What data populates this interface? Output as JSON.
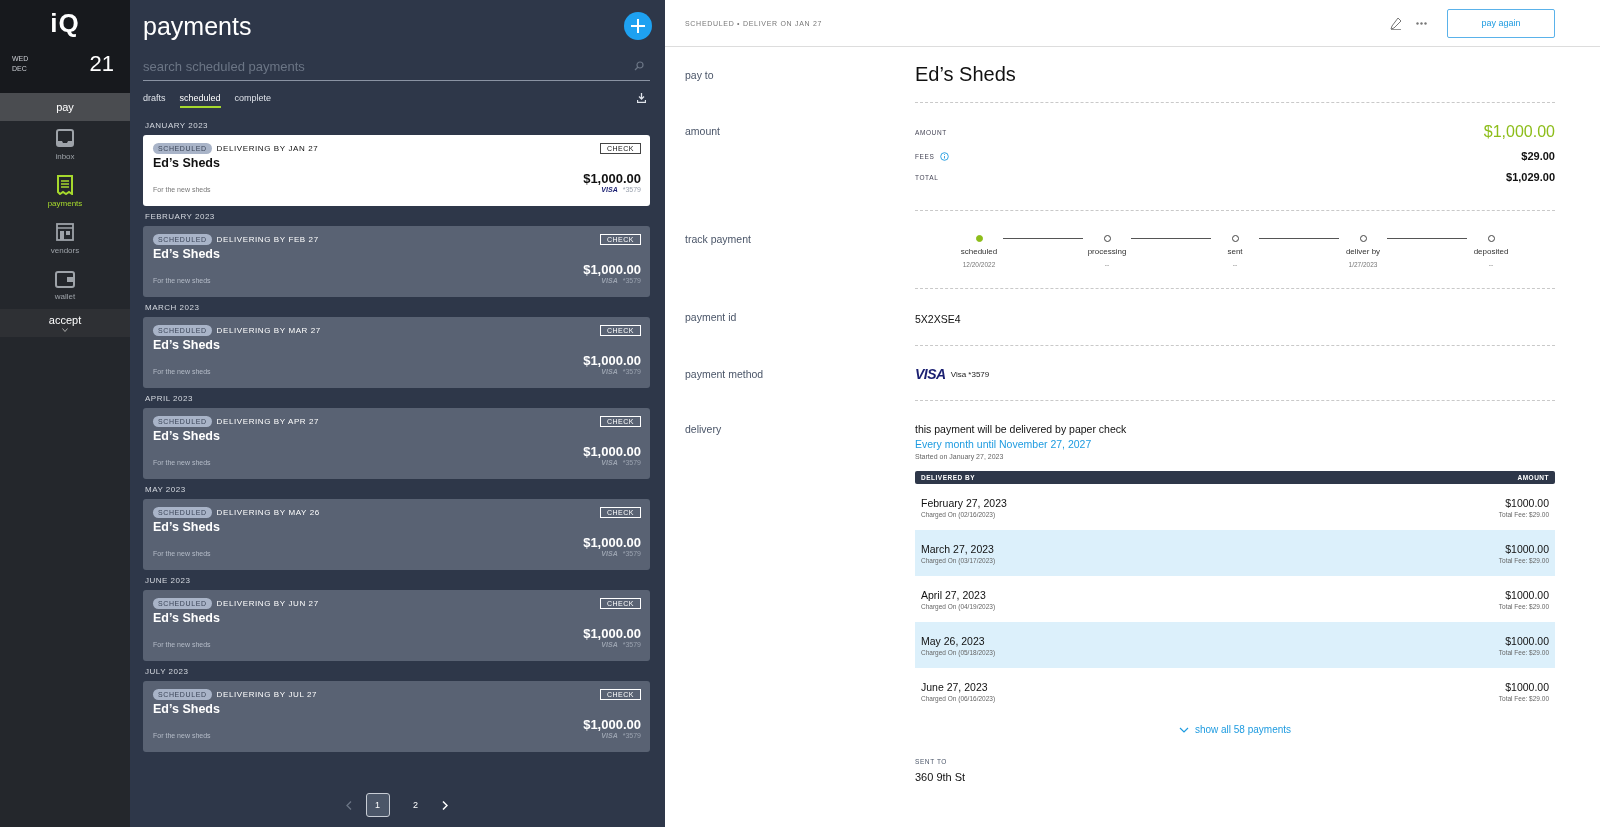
{
  "rail": {
    "logo": "iQ",
    "weekday": "WED",
    "month": "DEC",
    "day": "21",
    "nav": [
      {
        "label": "pay",
        "kind": "section",
        "selected": true
      },
      {
        "label": "inbox",
        "kind": "item",
        "selected": false
      },
      {
        "label": "payments",
        "kind": "item",
        "selected": true
      },
      {
        "label": "vendors",
        "kind": "item",
        "selected": false
      },
      {
        "label": "wallet",
        "kind": "item",
        "selected": false
      },
      {
        "label": "accept",
        "kind": "section",
        "selected": false
      }
    ]
  },
  "payments": {
    "title": "payments",
    "search": {
      "placeholder": "search scheduled payments"
    },
    "tabs": [
      {
        "label": "drafts",
        "selected": false
      },
      {
        "label": "scheduled",
        "selected": true
      },
      {
        "label": "complete",
        "selected": false
      }
    ],
    "groups": [
      {
        "month": "JANUARY 2023",
        "card": {
          "status": "SCHEDULED",
          "delivering": "DELIVERING BY JAN 27",
          "method": "CHECK",
          "payee": "Ed’s Sheds",
          "memo": "For the new sheds",
          "amount": "$1,000.00",
          "brand": "VISA",
          "last4": "*3579",
          "selected": true
        }
      },
      {
        "month": "FEBRUARY 2023",
        "card": {
          "status": "SCHEDULED",
          "delivering": "DELIVERING BY FEB 27",
          "method": "CHECK",
          "payee": "Ed’s Sheds",
          "memo": "For the new sheds",
          "amount": "$1,000.00",
          "brand": "VISA",
          "last4": "*3579",
          "selected": false
        }
      },
      {
        "month": "MARCH 2023",
        "card": {
          "status": "SCHEDULED",
          "delivering": "DELIVERING BY MAR 27",
          "method": "CHECK",
          "payee": "Ed’s Sheds",
          "memo": "For the new sheds",
          "amount": "$1,000.00",
          "brand": "VISA",
          "last4": "*3579",
          "selected": false
        }
      },
      {
        "month": "APRIL 2023",
        "card": {
          "status": "SCHEDULED",
          "delivering": "DELIVERING BY APR 27",
          "method": "CHECK",
          "payee": "Ed’s Sheds",
          "memo": "For the new sheds",
          "amount": "$1,000.00",
          "brand": "VISA",
          "last4": "*3579",
          "selected": false
        }
      },
      {
        "month": "MAY 2023",
        "card": {
          "status": "SCHEDULED",
          "delivering": "DELIVERING BY MAY 26",
          "method": "CHECK",
          "payee": "Ed’s Sheds",
          "memo": "For the new sheds",
          "amount": "$1,000.00",
          "brand": "VISA",
          "last4": "*3579",
          "selected": false
        }
      },
      {
        "month": "JUNE 2023",
        "card": {
          "status": "SCHEDULED",
          "delivering": "DELIVERING BY JUN 27",
          "method": "CHECK",
          "payee": "Ed’s Sheds",
          "memo": "For the new sheds",
          "amount": "$1,000.00",
          "brand": "VISA",
          "last4": "*3579",
          "selected": false
        }
      },
      {
        "month": "JULY 2023",
        "card": {
          "status": "SCHEDULED",
          "delivering": "DELIVERING BY JUL 27",
          "method": "CHECK",
          "payee": "Ed’s Sheds",
          "memo": "For the new sheds",
          "amount": "$1,000.00",
          "brand": "VISA",
          "last4": "*3579",
          "selected": false
        }
      }
    ],
    "pagination": [
      {
        "label": "1",
        "selected": true
      },
      {
        "label": "2",
        "selected": false
      }
    ]
  },
  "detail": {
    "status_line": "SCHEDULED • DELIVER ON JAN 27",
    "action": "pay again",
    "pay_to": {
      "label": "pay to",
      "value": "Ed’s Sheds"
    },
    "amount": {
      "label": "amount",
      "rows": [
        {
          "kind": "amount",
          "label": "AMOUNT",
          "value": "$1,000.00"
        },
        {
          "kind": "fees",
          "label": "FEES",
          "value": "$29.00"
        },
        {
          "kind": "total",
          "label": "TOTAL",
          "value": "$1,029.00"
        }
      ]
    },
    "track": {
      "label": "track payment",
      "steps": [
        {
          "label": "scheduled",
          "date": "12/20/2022",
          "done": true
        },
        {
          "label": "processing",
          "date": "--",
          "done": false
        },
        {
          "label": "sent",
          "date": "--",
          "done": false
        },
        {
          "label": "deliver by",
          "date": "1/27/2023",
          "done": false
        },
        {
          "label": "deposited",
          "date": "--",
          "done": false
        }
      ]
    },
    "payment_id": {
      "label": "payment id",
      "value": "5X2XSE4"
    },
    "payment_method": {
      "label": "payment method",
      "brand": "VISA",
      "text": "Visa *3579"
    },
    "delivery": {
      "label": "delivery",
      "note": "this payment will be delivered by paper check",
      "schedule": "Every month until November 27, 2027",
      "started": "Started on January 27, 2023",
      "columns": [
        "DELIVERED BY",
        "AMOUNT"
      ],
      "rows": [
        {
          "date": "February 27, 2023",
          "charged": "Charged On (02/16/2023)",
          "amount": "$1000.00",
          "fee": "Total Fee: $29.00"
        },
        {
          "date": "March 27, 2023",
          "charged": "Charged On (03/17/2023)",
          "amount": "$1000.00",
          "fee": "Total Fee: $29.00"
        },
        {
          "date": "April 27, 2023",
          "charged": "Charged On (04/19/2023)",
          "amount": "$1000.00",
          "fee": "Total Fee: $29.00"
        },
        {
          "date": "May 26, 2023",
          "charged": "Charged On (05/18/2023)",
          "amount": "$1000.00",
          "fee": "Total Fee: $29.00"
        },
        {
          "date": "June 27, 2023",
          "charged": "Charged On (06/16/2023)",
          "amount": "$1000.00",
          "fee": "Total Fee: $29.00"
        }
      ],
      "show_all": "show all 58 payments"
    },
    "sent_to": {
      "label": "SENT TO",
      "lines": [
        "360 9th St"
      ]
    }
  }
}
